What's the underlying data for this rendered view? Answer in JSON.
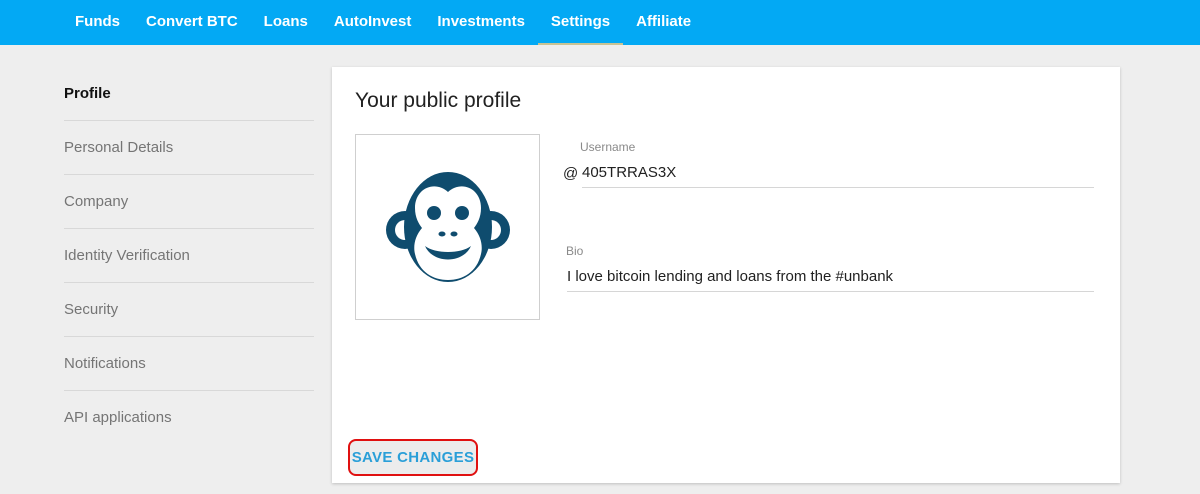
{
  "nav": {
    "items": [
      {
        "label": "Funds"
      },
      {
        "label": "Convert BTC"
      },
      {
        "label": "Loans"
      },
      {
        "label": "AutoInvest"
      },
      {
        "label": "Investments"
      },
      {
        "label": "Settings",
        "active": true
      },
      {
        "label": "Affiliate"
      }
    ]
  },
  "sidebar": {
    "items": [
      {
        "label": "Profile",
        "active": true
      },
      {
        "label": "Personal Details"
      },
      {
        "label": "Company"
      },
      {
        "label": "Identity Verification"
      },
      {
        "label": "Security"
      },
      {
        "label": "Notifications"
      },
      {
        "label": "API applications"
      }
    ]
  },
  "profile": {
    "title": "Your public profile",
    "avatar_icon": "monkey-avatar-icon",
    "username_label": "Username",
    "username_prefix": "@",
    "username_value": "405TRRAS3X",
    "bio_label": "Bio",
    "bio_value": "I love bitcoin lending and loans from the #unbank",
    "save_label": "SAVE CHANGES"
  },
  "colors": {
    "header": "#03a9f4",
    "avatar": "#0f4c6e",
    "save_text": "#2a9fd8",
    "highlight": "#e01010"
  }
}
